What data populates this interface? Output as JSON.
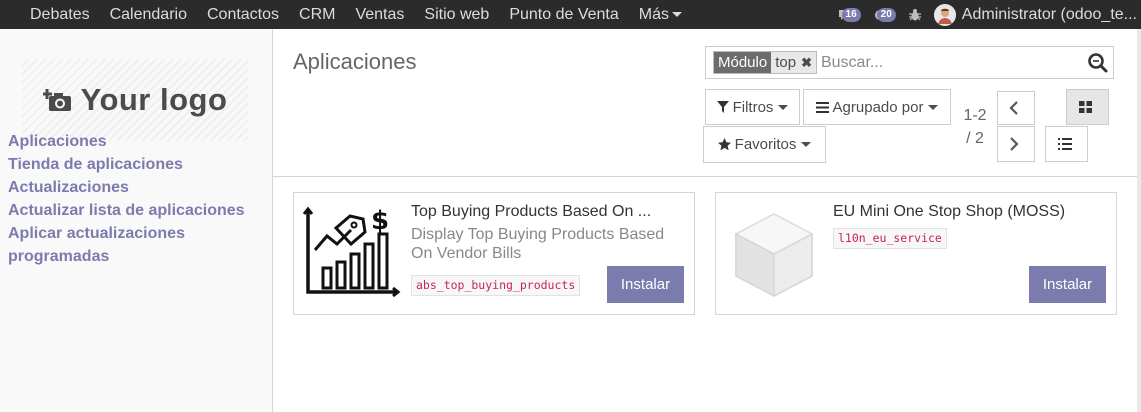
{
  "navbar": {
    "items": [
      "Debates",
      "Calendario",
      "Contactos",
      "CRM",
      "Ventas",
      "Sitio web",
      "Punto de Venta"
    ],
    "more_label": "Más",
    "messages_count": "16",
    "activities_count": "20",
    "user_name": "Administrator (odoo_te..."
  },
  "sidebar": {
    "logo_text": "Your logo",
    "items": [
      "Aplicaciones",
      "Tienda de aplicaciones",
      "Actualizaciones",
      "Actualizar lista de aplicaciones",
      "Aplicar actualizaciones programadas"
    ]
  },
  "control_panel": {
    "title": "Aplicaciones",
    "search": {
      "facet_label": "Módulo",
      "facet_value": "top",
      "placeholder": "Buscar..."
    },
    "filters_label": "Filtros",
    "groupby_label": "Agrupado por",
    "favorites_label": "Favoritos",
    "pager": {
      "value_line1": "1-2",
      "value_line2": "/ 2"
    }
  },
  "apps": [
    {
      "title": "Top Buying Products Based On ...",
      "summary": "Display Top Buying Products Based On Vendor Bills",
      "technical_name": "abs_top_buying_products",
      "install_label": "Instalar"
    },
    {
      "title": "EU Mini One Stop Shop (MOSS)",
      "summary": "",
      "technical_name": "l10n_eu_service",
      "install_label": "Instalar"
    }
  ],
  "colors": {
    "navbar_bg": "#2b2b2b",
    "brand": "#7c7bad",
    "tech_name": "#c7254e"
  }
}
